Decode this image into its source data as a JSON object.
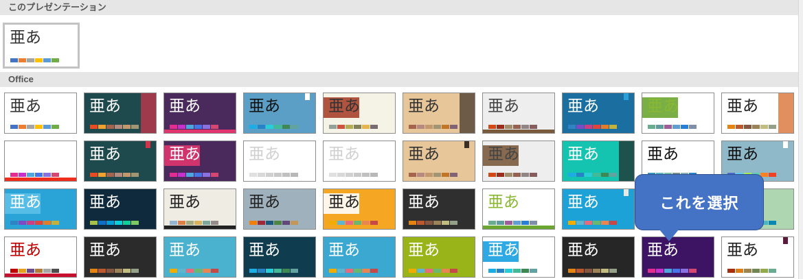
{
  "sections": {
    "current": "このプレゼンテーション",
    "office": "Office"
  },
  "callout": {
    "text": "これを選択"
  },
  "themes": [
    {
      "sample": "亜あ",
      "bg": "#ffffff",
      "fg": "#333333",
      "sw": [
        "#4472c4",
        "#ed7d31",
        "#a5a5a5",
        "#ffc000",
        "#5b9bd5",
        "#70ad47"
      ]
    },
    {
      "sample": "亜あ",
      "bg": "#ffffff",
      "fg": "#333333",
      "sw": [
        "#4472c4",
        "#ed7d31",
        "#a5a5a5",
        "#ffc000",
        "#5b9bd5",
        "#70ad47"
      ]
    },
    {
      "sample": "亜あ",
      "bg": "#1e4a4e",
      "fg": "#ffffff",
      "accent": "#d4334a",
      "sw": [
        "#e84c22",
        "#f0a22e",
        "#a5644e",
        "#b58b80",
        "#c3986d",
        "#a19574"
      ]
    },
    {
      "sample": "亜あ",
      "bg": "#4a2a5c",
      "fg": "#ffffff",
      "accent": "#e0356e",
      "sw": [
        "#e32d91",
        "#c830cc",
        "#4ea6dc",
        "#4775e7",
        "#8971e1",
        "#d54773"
      ]
    },
    {
      "sample": "亜あ",
      "bg": "#5b9fc6",
      "fg": "#111111",
      "accent": "#ffffff",
      "sw": [
        "#1cade4",
        "#2683c6",
        "#27ced7",
        "#42ba97",
        "#3e8853",
        "#62a39f"
      ]
    },
    {
      "sample": "亜あ",
      "bg": "#f4f3e6",
      "fg": "#333333",
      "accent": "#a8422d",
      "sw": [
        "#93a299",
        "#cf543f",
        "#b5ae53",
        "#848058",
        "#e8b54d",
        "#786c71"
      ]
    },
    {
      "sample": "亜あ",
      "bg": "#e7c799",
      "fg": "#333333",
      "accent": "#3b2e24",
      "sw": [
        "#a5644e",
        "#b58b80",
        "#c3986d",
        "#a19574",
        "#c17529",
        "#826277"
      ]
    },
    {
      "sample": "亜あ",
      "bg": "#efeeee",
      "fg": "#444444",
      "accent": "#7a5a3c",
      "sw": [
        "#d34817",
        "#9b2d1f",
        "#a28e6a",
        "#956251",
        "#918485",
        "#855d5d"
      ]
    },
    {
      "sample": "亜あ",
      "bg": "#1a6fa0",
      "fg": "#ffffff",
      "accent": "#2ba0d8",
      "sw": [
        "#2e83c3",
        "#7c4ac2",
        "#cb3e86",
        "#e0443f",
        "#e07c2a",
        "#c4b13b"
      ]
    },
    {
      "sample": "亜あ",
      "bg": "#ffffff",
      "fg": "#8ab833",
      "accent": "#6aa630",
      "sw": [
        "#6aac90",
        "#5f9c9d",
        "#9e5e9b",
        "#629dd1",
        "#297fd5",
        "#7f8fa9"
      ]
    },
    {
      "sample": "亜あ",
      "bg": "#ffffff",
      "fg": "#222222",
      "accent": "#d65f1c",
      "sw": [
        "#e48312",
        "#bd582c",
        "#865640",
        "#9b8357",
        "#c2bc80",
        "#94a088"
      ]
    },
    {
      "sample": "亜あ",
      "bg": "#ffffff",
      "fg": "#ffffff",
      "accent": "#ef2d1c",
      "sw": [
        "#e32d91",
        "#c830cc",
        "#4ea6dc",
        "#4775e7",
        "#8971e1",
        "#d54773"
      ]
    },
    {
      "sample": "亜あ",
      "bg": "#1e4a4e",
      "fg": "#ffffff",
      "accent": "#d4334a",
      "sw": [
        "#e84c22",
        "#f0a22e",
        "#a5644e",
        "#b58b80",
        "#c3986d",
        "#a19574"
      ]
    },
    {
      "sample": "亜あ",
      "bg": "#4a2a5c",
      "fg": "#ffffff",
      "accent": "#e0356e",
      "sw": [
        "#e32d91",
        "#c830cc",
        "#4ea6dc",
        "#4775e7",
        "#8971e1",
        "#d54773"
      ]
    },
    {
      "sample": "亜あ",
      "bg": "#ffffff",
      "fg": "#d0d0d0",
      "sw": [
        "#e0e0e0",
        "#d8d8d8",
        "#d0d0d0",
        "#c8c8c8",
        "#c0c0c0",
        "#b8b8b8"
      ]
    },
    {
      "sample": "亜あ",
      "bg": "#ffffff",
      "fg": "#d0d0d0",
      "sw": [
        "#e0e0e0",
        "#d8d8d8",
        "#d0d0d0",
        "#c8c8c8",
        "#c0c0c0",
        "#b8b8b8"
      ]
    },
    {
      "sample": "亜あ",
      "bg": "#e7c799",
      "fg": "#333333",
      "accent": "#3b2e24",
      "sw": [
        "#a5644e",
        "#b58b80",
        "#c3986d",
        "#a19574",
        "#c17529",
        "#826277"
      ]
    },
    {
      "sample": "亜あ",
      "bg": "#efeeee",
      "fg": "#444444",
      "accent": "#7a5a3c",
      "sw": [
        "#d34817",
        "#9b2d1f",
        "#a28e6a",
        "#956251",
        "#918485",
        "#855d5d"
      ]
    },
    {
      "sample": "亜あ",
      "bg": "#14c3b0",
      "fg": "#ffffff",
      "accent": "#222222",
      "sw": [
        "#1cade4",
        "#2683c6",
        "#27ced7",
        "#42ba97",
        "#3e8853",
        "#62a39f"
      ]
    },
    {
      "sample": "亜あ",
      "bg": "#ffffff",
      "fg": "#111111",
      "sw": [
        "#3494ba",
        "#58b6c0",
        "#75bda7",
        "#7a8c8e",
        "#84acb6",
        "#2683c6"
      ]
    },
    {
      "sample": "亜あ",
      "bg": "#8fb8c9",
      "fg": "#111111",
      "accent": "#ffffff",
      "sw": [
        "#4e67c8",
        "#5eccf3",
        "#a7ea52",
        "#5dceaf",
        "#ff8021",
        "#f14124"
      ]
    },
    {
      "sample": "亜あ",
      "bg": "#2aa3d6",
      "fg": "#ffffff",
      "accent": "#5bc1e8",
      "sw": [
        "#2e83c3",
        "#7c4ac2",
        "#cb3e86",
        "#e0443f",
        "#e07c2a",
        "#c4b13b"
      ]
    },
    {
      "sample": "亜あ",
      "bg": "#0e2a3c",
      "fg": "#ffffff",
      "sw": [
        "#a5c249",
        "#0f6fc6",
        "#009dd9",
        "#0bd0d9",
        "#10cf9b",
        "#7cca62"
      ]
    },
    {
      "sample": "亜あ",
      "bg": "#efece4",
      "fg": "#222222",
      "accent": "#222222",
      "sw": [
        "#94b6d2",
        "#dd8047",
        "#a5ab81",
        "#d8b25c",
        "#7ba79d",
        "#968c8c"
      ]
    },
    {
      "sample": "亜あ",
      "bg": "#9fb1bc",
      "fg": "#222222",
      "sw": [
        "#f07f09",
        "#9f2936",
        "#1b587c",
        "#4e8542",
        "#604878",
        "#c19859"
      ]
    },
    {
      "sample": "亜あ",
      "bg": "#f5a623",
      "fg": "#222222",
      "accent": "#ffffff",
      "sw": [
        "#f0ad00",
        "#60b5cc",
        "#e66c7d",
        "#6bb76d",
        "#e88651",
        "#c64847"
      ]
    },
    {
      "sample": "亜あ",
      "bg": "#2f2f2f",
      "fg": "#ffffff",
      "sw": [
        "#e48312",
        "#bd582c",
        "#865640",
        "#9b8357",
        "#c2bc80",
        "#94a088"
      ]
    },
    {
      "sample": "亜あ",
      "bg": "#ffffff",
      "fg": "#8ab833",
      "accent": "#6aa630",
      "sw": [
        "#6aac90",
        "#5f9c9d",
        "#9e5e9b",
        "#629dd1",
        "#297fd5",
        "#7f8fa9"
      ]
    },
    {
      "sample": "亜あ",
      "bg": "#1da2d8",
      "fg": "#ffffff",
      "accent": "#e8e8e8",
      "sw": [
        "#f0ad00",
        "#60b5cc",
        "#e66c7d",
        "#6bb76d",
        "#e88651",
        "#c64847"
      ]
    },
    {
      "sample": "亜あ",
      "bg": "#1da2d8",
      "fg": "#ffffff",
      "sw": [
        "#f0ad00",
        "#60b5cc",
        "#e66c7d",
        "#6bb76d",
        "#e88651",
        "#c64847"
      ]
    },
    {
      "sample": "亜あ",
      "bg": "#aed7b1",
      "fg": "#222222",
      "sw": [
        "#549e39",
        "#8ab833",
        "#c0cf3a",
        "#029676",
        "#4ab5c4",
        "#0989b1"
      ]
    },
    {
      "sample": "亜あ",
      "bg": "#ffffff",
      "fg": "#c00000",
      "accent": "#c8102e",
      "sw": [
        "#c00000",
        "#e4a01e",
        "#6e4c8c",
        "#ae7d3c",
        "#a7a7a7",
        "#4e4e4e"
      ]
    },
    {
      "sample": "亜あ",
      "bg": "#2b2b2b",
      "fg": "#ffffff",
      "sw": [
        "#e48312",
        "#bd582c",
        "#865640",
        "#9b8357",
        "#c2bc80",
        "#94a088"
      ]
    },
    {
      "sample": "亜あ",
      "bg": "#4ab1cf",
      "fg": "#ffffff",
      "sw": [
        "#f0ad00",
        "#60b5cc",
        "#e66c7d",
        "#6bb76d",
        "#e88651",
        "#c64847"
      ]
    },
    {
      "sample": "亜あ",
      "bg": "#0f3d4f",
      "fg": "#ffffff",
      "sw": [
        "#1cade4",
        "#2683c6",
        "#27ced7",
        "#42ba97",
        "#3e8853",
        "#62a39f"
      ]
    },
    {
      "sample": "亜あ",
      "bg": "#3aa8d0",
      "fg": "#ffffff",
      "sw": [
        "#f0ad00",
        "#60b5cc",
        "#e66c7d",
        "#6bb76d",
        "#e88651",
        "#c64847"
      ]
    },
    {
      "sample": "亜あ",
      "bg": "#99b419",
      "fg": "#ffffff",
      "sw": [
        "#f0ad00",
        "#60b5cc",
        "#e66c7d",
        "#6bb76d",
        "#e88651",
        "#c64847"
      ]
    },
    {
      "sample": "亜あ",
      "bg": "#ffffff",
      "fg": "#ffffff",
      "accent": "#18a0e0",
      "sw": [
        "#1cade4",
        "#2683c6",
        "#27ced7",
        "#42ba97",
        "#3e8853",
        "#62a39f"
      ]
    },
    {
      "sample": "亜あ",
      "bg": "#262626",
      "fg": "#ffffff",
      "sw": [
        "#e48312",
        "#bd582c",
        "#865640",
        "#9b8357",
        "#c2bc80",
        "#94a088"
      ]
    },
    {
      "sample": "亜あ",
      "bg": "#3d1363",
      "fg": "#ffffff",
      "sw": [
        "#e32d91",
        "#c830cc",
        "#4ea6dc",
        "#4775e7",
        "#8971e1",
        "#d54773"
      ]
    },
    {
      "sample": "亜あ",
      "bg": "#ffffff",
      "fg": "#222222",
      "accent": "#5a1a3a",
      "sw": [
        "#a53010",
        "#de7e18",
        "#9f8351",
        "#728653",
        "#92aa4c",
        "#6aac91"
      ]
    }
  ]
}
